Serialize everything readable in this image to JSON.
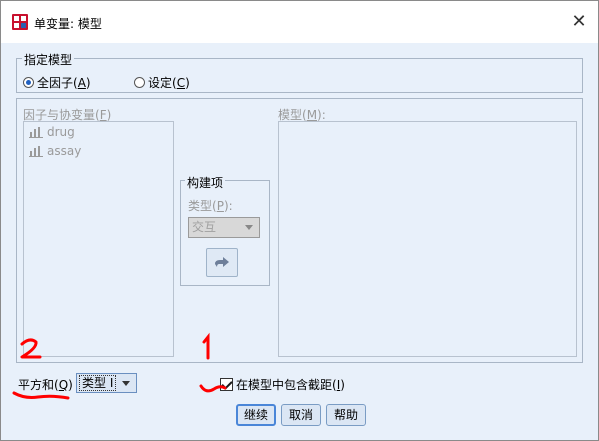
{
  "window": {
    "title": "单变量: 模型",
    "close_label": "✕",
    "icon": "spss-app-icon"
  },
  "specify_model": {
    "legend": "指定模型",
    "options": [
      {
        "label_before": "全因子(",
        "mnemonic": "A",
        "label_after": ")",
        "selected": true
      },
      {
        "label_before": "设定(",
        "mnemonic": "C",
        "label_after": ")",
        "selected": false
      }
    ]
  },
  "factors": {
    "label_before": "因子与协变量(",
    "mnemonic": "F",
    "label_after": ")",
    "items": [
      {
        "name": "drug",
        "icon": "scale-variable-icon"
      },
      {
        "name": "assay",
        "icon": "scale-variable-icon"
      }
    ]
  },
  "build_term": {
    "legend": "构建项",
    "type_label_before": "类型(",
    "type_mnemonic": "P",
    "type_label_after": "):",
    "type_value": "交互",
    "arrow_icon": "right-arrow-icon"
  },
  "model": {
    "label_before": "模型(",
    "mnemonic": "M",
    "label_after": "):"
  },
  "sum_of_squares": {
    "label_before": "平方和(",
    "mnemonic": "Q",
    "label_after": ")",
    "value": "类型 I"
  },
  "include_intercept": {
    "label_before": "在模型中包含截距(",
    "mnemonic": "I",
    "label_after": ")",
    "checked": true
  },
  "buttons": {
    "continue": "继续",
    "cancel": "取消",
    "help": "帮助"
  },
  "annotations": [
    {
      "text": "2",
      "color": "#ff0000"
    },
    {
      "text": "1",
      "color": "#ff0000"
    }
  ]
}
